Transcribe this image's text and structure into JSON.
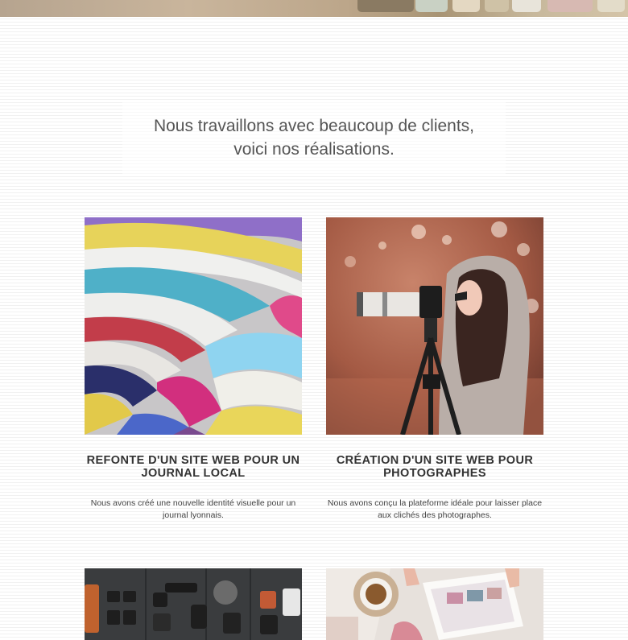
{
  "intro": {
    "line1": "Nous travaillons avec beaucoup de clients,",
    "line2": "voici nos réalisations."
  },
  "projects": [
    {
      "title": "REFONTE D'UN SITE WEB POUR UN JOURNAL LOCAL",
      "description": "Nous avons créé une nouvelle identité visuelle pour un journal lyonnais.",
      "image": "stacked-magazines-photo"
    },
    {
      "title": "CRÉATION D'UN SITE WEB POUR PHOTOGRAPHES",
      "description": "Nous avons conçu la plateforme idéale pour laisser place aux clichés des photographes.",
      "image": "photographer-camera-tripod-photo"
    },
    {
      "image": "camera-equipment-flatlay-photo"
    },
    {
      "image": "tablet-coffee-desk-photo"
    }
  ],
  "colors": {
    "heading": "#333333",
    "intro_text": "#555555",
    "body_text": "#444444",
    "page_background": "#ffffff"
  }
}
